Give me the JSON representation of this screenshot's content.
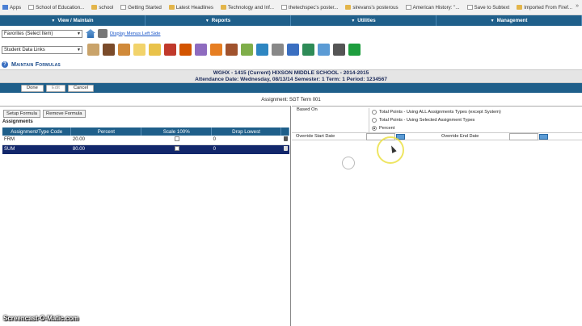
{
  "bookmarks": [
    {
      "label": "Apps",
      "icon": "grid"
    },
    {
      "label": "School of Education...",
      "icon": "page"
    },
    {
      "label": "school",
      "icon": "folder"
    },
    {
      "label": "Getting Started",
      "icon": "page"
    },
    {
      "label": "Latest Headlines",
      "icon": "folder"
    },
    {
      "label": "Technology and Inf...",
      "icon": "folder"
    },
    {
      "label": "thetechspec's poster...",
      "icon": "page"
    },
    {
      "label": "slrevans's posterous",
      "icon": "folder"
    },
    {
      "label": "American History: \"...",
      "icon": "page"
    },
    {
      "label": "Save to Subtext",
      "icon": "page"
    },
    {
      "label": "Imported From Firef...",
      "icon": "folder"
    }
  ],
  "bookmarks_more": "»",
  "menu": [
    {
      "label": "View / Maintain"
    },
    {
      "label": "Reports"
    },
    {
      "label": "Utilities"
    },
    {
      "label": "Management"
    }
  ],
  "favorites": {
    "value": "Favorites (Select Item)",
    "display_link": "Display Menus Left Side"
  },
  "student_links": {
    "value": "Student Data Links"
  },
  "toolbar_icons": [
    "id-card-icon",
    "books-icon",
    "person-icon",
    "pencil-icon",
    "envelope-icon",
    "bus-icon",
    "teacher-icon",
    "report-icon",
    "calendar-icon",
    "book-icon",
    "people-icon",
    "compass-icon",
    "columns-icon",
    "grid-icon",
    "puzzle-icon",
    "tools-icon",
    "printer-icon",
    "dollar-icon"
  ],
  "page_title": "Maintain Formulas",
  "school": {
    "line1": "WGHX - 1415 (Current) HIXSON MIDDLE SCHOOL - 2014-2015",
    "line2": "Attendance Date: Wednesday, 08/13/14   Semester: 1   Term: 1   Period: 1234567"
  },
  "actions": {
    "done": "Done",
    "edit": "Edit",
    "cancel": "Cancel"
  },
  "assignment_label": "Assignment: SGT Term 001",
  "formula_buttons": {
    "setup": "Setup Formula",
    "remove": "Remove Formula"
  },
  "assignments_label": "Assignments",
  "table": {
    "headers": [
      "Assignment/Type Code",
      "Percent",
      "Scale 100%",
      "Drop Lowest"
    ],
    "rows": [
      {
        "code": "FRM",
        "percent": "20.00",
        "scale": false,
        "drop": "0"
      },
      {
        "code": "SUM",
        "percent": "80.00",
        "scale": false,
        "drop": "0"
      }
    ]
  },
  "based_on": {
    "label": "Based On",
    "options": [
      "Total Points - Using ALL Assignments Types (except System)",
      "Total Points - Using Selected Assignment Types",
      "Percent"
    ],
    "selected_index": 2
  },
  "override": {
    "start_label": "Override Start Date",
    "end_label": "Override End Date",
    "start_value": "",
    "end_value": ""
  },
  "watermark": "Screencast-O-Matic.com"
}
